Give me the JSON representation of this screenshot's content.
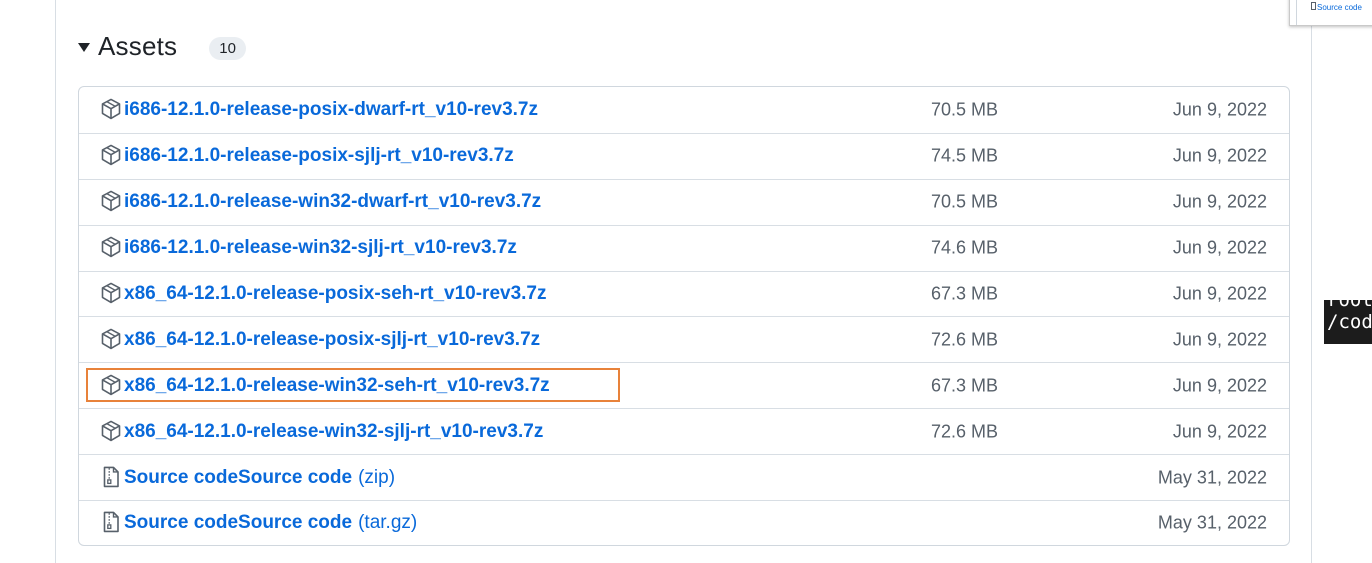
{
  "assets": {
    "title": "Assets",
    "count": "10",
    "rows": [
      {
        "name": "i686-12.1.0-release-posix-dwarf-rt_v10-rev3.7z",
        "suffix": "",
        "size": "70.5 MB",
        "date": "Jun 9, 2022",
        "icon": "package-icon"
      },
      {
        "name": "i686-12.1.0-release-posix-sjlj-rt_v10-rev3.7z",
        "suffix": "",
        "size": "74.5 MB",
        "date": "Jun 9, 2022",
        "icon": "package-icon"
      },
      {
        "name": "i686-12.1.0-release-win32-dwarf-rt_v10-rev3.7z",
        "suffix": "",
        "size": "70.5 MB",
        "date": "Jun 9, 2022",
        "icon": "package-icon"
      },
      {
        "name": "i686-12.1.0-release-win32-sjlj-rt_v10-rev3.7z",
        "suffix": "",
        "size": "74.6 MB",
        "date": "Jun 9, 2022",
        "icon": "package-icon"
      },
      {
        "name": "x86_64-12.1.0-release-posix-seh-rt_v10-rev3.7z",
        "suffix": "",
        "size": "67.3 MB",
        "date": "Jun 9, 2022",
        "icon": "package-icon"
      },
      {
        "name": "x86_64-12.1.0-release-posix-sjlj-rt_v10-rev3.7z",
        "suffix": "",
        "size": "72.6 MB",
        "date": "Jun 9, 2022",
        "icon": "package-icon"
      },
      {
        "name": "x86_64-12.1.0-release-win32-seh-rt_v10-rev3.7z",
        "suffix": "",
        "size": "67.3 MB",
        "date": "Jun 9, 2022",
        "icon": "package-icon"
      },
      {
        "name": "x86_64-12.1.0-release-win32-sjlj-rt_v10-rev3.7z",
        "suffix": "",
        "size": "72.6 MB",
        "date": "Jun 9, 2022",
        "icon": "package-icon"
      },
      {
        "name": "Source code",
        "suffix": "(zip)",
        "size": "",
        "date": "May 31, 2022",
        "icon": "file-zip-icon"
      },
      {
        "name": "Source code",
        "suffix": "(tar.gz)",
        "size": "",
        "date": "May 31, 2022",
        "icon": "file-zip-icon"
      }
    ]
  },
  "highlight": {
    "color": "#e8823a",
    "row_index": 6
  },
  "thumbnail": {
    "text": "Source code"
  },
  "terminal_tooltip": {
    "line1": "root",
    "line2": "/code"
  },
  "colors": {
    "link": "#0969da",
    "muted": "#57606a",
    "border": "#d0d7de",
    "highlight": "#e8823a"
  }
}
